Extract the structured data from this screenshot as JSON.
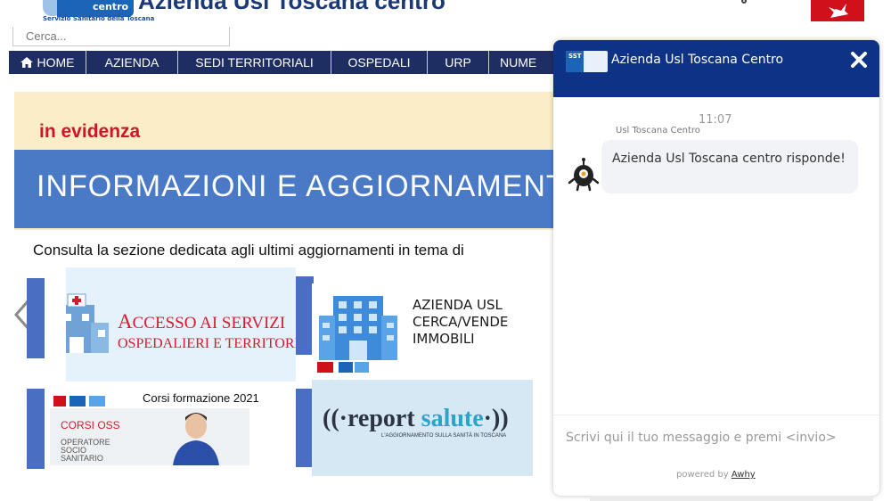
{
  "header": {
    "logo_word": "centro",
    "logo_sub": "Servizio Sanitario della Toscana",
    "site_title": "Azienda Usl Toscana centro"
  },
  "search": {
    "placeholder": "Cerca..."
  },
  "nav": {
    "items": [
      {
        "label": "HOME",
        "icon": "home-icon"
      },
      {
        "label": "AZIENDA"
      },
      {
        "label": "SEDI TERRITORIALI"
      },
      {
        "label": "OSPEDALI"
      },
      {
        "label": "URP"
      },
      {
        "label": "NUME"
      }
    ]
  },
  "banner": {
    "evidence": "in evidenza",
    "title": "INFORMAZIONI E AGGIORNAMENTI",
    "consult": "Consulta la sezione dedicata agli ultimi aggiornamenti in tema di"
  },
  "tiles": {
    "access": {
      "big": "A",
      "rest": "CCESSO AI SERVIZI",
      "sub": "OSPEDALIERI E TERRITORIALI"
    },
    "immobili": {
      "line1": "AZIENDA USL",
      "line2": "CERCA/VENDE",
      "line3": "IMMOBILI"
    },
    "corsi": {
      "title": "Corsi formazione 2021",
      "oss": "CORSI OSS",
      "op1": "OPERATORE",
      "op2": "SOCIO",
      "op3": "SANITARIO"
    },
    "report": {
      "a": "((·report ",
      "hl": "salute",
      "b": "·))",
      "sub": "L'AGGIORNAMENTO SULLA SANITÀ IN TOSCANA"
    }
  },
  "chat": {
    "title": "Azienda Usl Toscana Centro",
    "time": "11:07",
    "sender": "Usl Toscana Centro",
    "message": "Azienda Usl Toscana centro risponde!",
    "input_placeholder": "Scrivi qui il tuo messaggio e premi <invio>",
    "powered_by": "powered by",
    "powered_link": "Awhy",
    "logo_text": "SST"
  },
  "colors": {
    "nav_bg": "#1e2e63",
    "chat_header": "#0e3286",
    "banner_blue": "#4a79c6",
    "accent_red": "#d0142a"
  }
}
